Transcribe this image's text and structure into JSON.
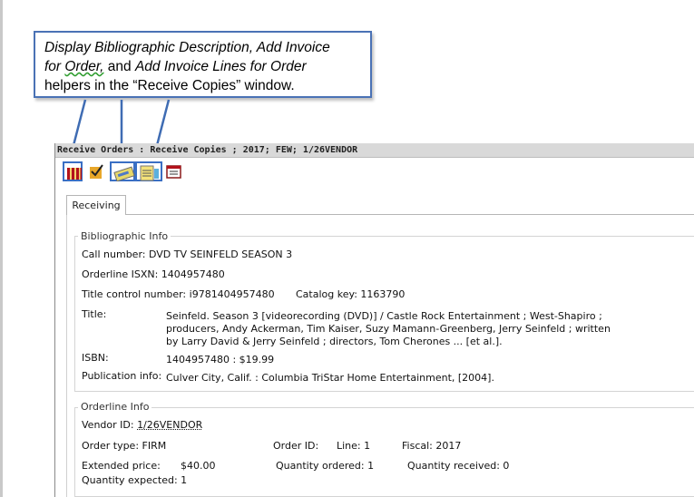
{
  "callout": {
    "line1": "Display Bibliographic Description, Add Invoice",
    "line2a": "for",
    "line2b": "Order,",
    "line2c": " and ",
    "line2d": "Add Invoice Lines for Order",
    "line3": "helpers in the “Receive Copies” window."
  },
  "window": {
    "title": "Receive Orders : Receive Copies  ; 2017; FEW; 1/26VENDOR"
  },
  "toolbar": {
    "icons": [
      "bib-description-icon",
      "add-invoice-icon",
      "add-invoice-lines-icon",
      "notes-icon",
      "calendar-icon"
    ]
  },
  "tabs": {
    "receiving": "Receiving"
  },
  "bib": {
    "legend": "Bibliographic Info",
    "call_number": "Call number: DVD TV SEINFELD SEASON 3",
    "orderline_isxn": "Orderline ISXN: 1404957480",
    "title_control": "Title control number:  i9781404957480",
    "catalog_key": "Catalog key:  1163790",
    "title_label": "Title:",
    "title_line1": "Seinfeld. Season 3 [videorecording (DVD)] / Castle Rock Entertainment ; West-Shapiro ;",
    "title_line2": "producers, Andy Ackerman, Tim Kaiser, Suzy Mamann-Greenberg, Jerry Seinfeld ; written",
    "title_line3": "by Larry David & Jerry Seinfeld ; directors, Tom Cherones ... [et al.].",
    "isbn_label": "ISBN:",
    "isbn_value": "1404957480 : $19.99",
    "pub_label": "Publication info:",
    "pub_value": "Culver City, Calif. : Columbia TriStar Home Entertainment, [2004]."
  },
  "orderline": {
    "legend": "Orderline Info",
    "vendor_label": "Vendor ID:",
    "vendor_value": "1/26VENDOR",
    "order_type": "Order type: FIRM",
    "order_id": "Order ID:",
    "line": "Line: 1",
    "fiscal": "Fiscal: 2017",
    "extended_label": "Extended price:",
    "extended_value": "$40.00",
    "qty_ordered": "Quantity ordered: 1",
    "qty_received": "Quantity received: 0",
    "qty_expected": "Quantity expected: 1"
  }
}
